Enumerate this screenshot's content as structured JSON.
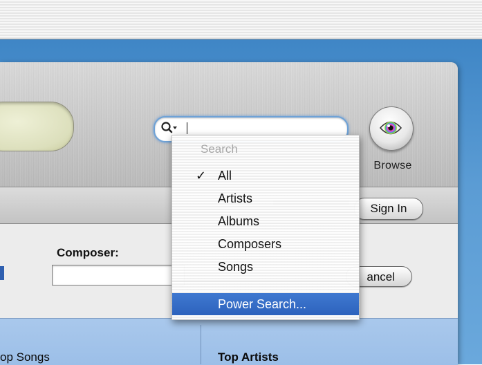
{
  "search_menu": {
    "header": "Search",
    "items": [
      {
        "label": "All",
        "checked": true
      },
      {
        "label": "Artists",
        "checked": false
      },
      {
        "label": "Albums",
        "checked": false
      },
      {
        "label": "Composers",
        "checked": false
      },
      {
        "label": "Songs",
        "checked": false
      }
    ],
    "power_search": "Power Search..."
  },
  "toolbar": {
    "browse_label": "Browse",
    "search_value": ""
  },
  "store": {
    "signin_label": "Sign In",
    "composer_label": "Composer:",
    "composer_value": "",
    "cancel_label": "ancel",
    "top_songs_label": "op Songs",
    "top_artists_label": "Top Artists"
  },
  "colors": {
    "selection": "#2d63bd",
    "desktop": "#5b9cd4",
    "list_header": "#a9c8ec"
  },
  "icons": {
    "search": "magnifier-dropdown-icon",
    "browse": "eye-icon",
    "check": "checkmark-icon"
  }
}
